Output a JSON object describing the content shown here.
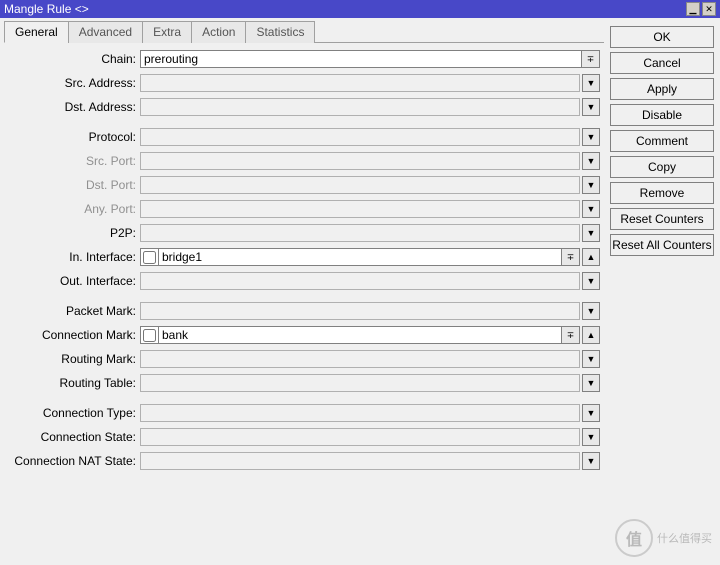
{
  "window": {
    "title": "Mangle Rule <>"
  },
  "tabs": {
    "general": "General",
    "advanced": "Advanced",
    "extra": "Extra",
    "action": "Action",
    "statistics": "Statistics"
  },
  "labels": {
    "chain": "Chain:",
    "src_address": "Src. Address:",
    "dst_address": "Dst. Address:",
    "protocol": "Protocol:",
    "src_port": "Src. Port:",
    "dst_port": "Dst. Port:",
    "any_port": "Any. Port:",
    "p2p": "P2P:",
    "in_interface": "In. Interface:",
    "out_interface": "Out. Interface:",
    "packet_mark": "Packet Mark:",
    "connection_mark": "Connection Mark:",
    "routing_mark": "Routing Mark:",
    "routing_table": "Routing Table:",
    "connection_type": "Connection Type:",
    "connection_state": "Connection State:",
    "connection_nat_state": "Connection NAT State:"
  },
  "values": {
    "chain": "prerouting",
    "src_address": "",
    "dst_address": "",
    "protocol": "",
    "src_port": "",
    "dst_port": "",
    "any_port": "",
    "p2p": "",
    "in_interface": "bridge1",
    "out_interface": "",
    "packet_mark": "",
    "connection_mark": "bank",
    "routing_mark": "",
    "routing_table": "",
    "connection_type": "",
    "connection_state": "",
    "connection_nat_state": ""
  },
  "buttons": {
    "ok": "OK",
    "cancel": "Cancel",
    "apply": "Apply",
    "disable": "Disable",
    "comment": "Comment",
    "copy": "Copy",
    "remove": "Remove",
    "reset_counters": "Reset Counters",
    "reset_all_counters": "Reset All Counters"
  },
  "glyphs": {
    "dd": "∓",
    "up": "▲",
    "down": "▼"
  },
  "watermark": {
    "badge": "值",
    "text": "什么值得买"
  }
}
